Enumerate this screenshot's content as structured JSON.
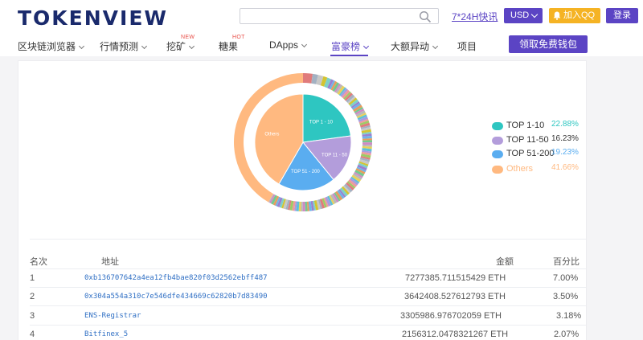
{
  "header": {
    "logo": "TOKENVIEW",
    "search_placeholder": "",
    "link_24h": "7*24H快讯",
    "currency": "USD",
    "qq_label": "加入QQ群",
    "login_label": "登录",
    "wallet_button": "领取免费钱包"
  },
  "nav": {
    "items": [
      {
        "label": "区块链浏览器",
        "badge": ""
      },
      {
        "label": "行情预测",
        "badge": ""
      },
      {
        "label": "挖矿",
        "badge": "NEW"
      },
      {
        "label": "糖果",
        "badge": "HOT"
      },
      {
        "label": "DApps",
        "badge": ""
      },
      {
        "label": "富豪榜",
        "badge": ""
      },
      {
        "label": "大额异动",
        "badge": ""
      },
      {
        "label": "项目",
        "badge": ""
      }
    ]
  },
  "chart_data": {
    "type": "pie",
    "categories": [
      "TOP 1 - 10",
      "TOP 11 - 50",
      "TOP 51 - 200",
      "Others"
    ],
    "values": [
      22.88,
      16.23,
      19.23,
      41.66
    ],
    "colors": [
      "#2ec6c1",
      "#b39ddb",
      "#5aadf0",
      "#ffb980"
    ],
    "slice_labels": [
      "TOP 1 - 10",
      "TOP 11 - 50",
      "TOP 51 - 200",
      "Others"
    ],
    "legend": [
      {
        "label": "TOP 1-10",
        "pct": "22.88%",
        "color": "#2ec6c1"
      },
      {
        "label": "TOP 11-50",
        "pct": "16.23%",
        "color": "#b39ddb"
      },
      {
        "label": "TOP 51-200",
        "pct": "19.23%",
        "color": "#5aadf0"
      },
      {
        "label": "Others",
        "pct": "41.66%",
        "color": "#ffb980"
      }
    ],
    "legend_placement": "right"
  },
  "table": {
    "headers": {
      "rank": "名次",
      "address": "地址",
      "amount": "金额",
      "percent": "百分比"
    },
    "rows": [
      {
        "rank": "1",
        "address": "0xb136707642a4ea12fb4bae820f03d2562ebff487",
        "amount": "7277385.711515429 ETH",
        "percent": "7.00%"
      },
      {
        "rank": "2",
        "address": "0x304a554a310c7e546dfe434669c62820b7d83490",
        "amount": "3642408.527612793 ETH",
        "percent": "3.50%"
      },
      {
        "rank": "3",
        "address": "ENS-Registrar",
        "amount": "3305986.976702059 ETH",
        "percent": "3.18%"
      },
      {
        "rank": "4",
        "address": "Bitfinex_5",
        "amount": "2156312.0478321267 ETH",
        "percent": "2.07%"
      }
    ]
  },
  "colors": {
    "brand": "#5b44c4",
    "qq": "#f5b324",
    "badge": "#e8504a",
    "link": "#2f6fc4"
  }
}
